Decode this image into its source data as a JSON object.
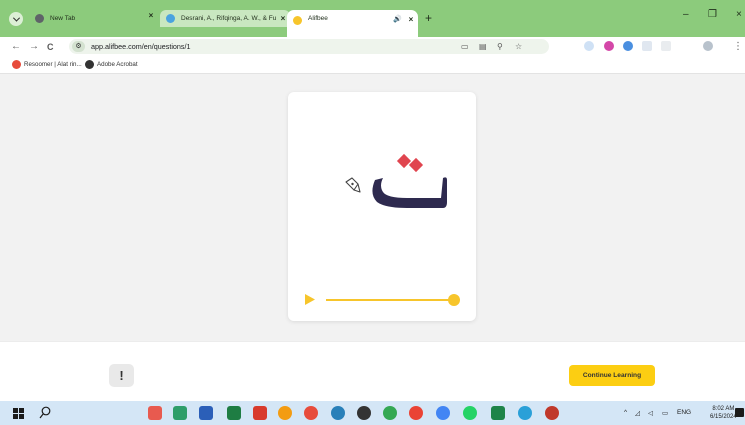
{
  "browser": {
    "tabs": [
      {
        "title": "New Tab",
        "favicon_color": "#5f6368"
      },
      {
        "title": "Desrani, A., Rifqinga, A. W., & Fu",
        "favicon_color": "#4aa3df"
      },
      {
        "title": "Alifbee",
        "favicon_color": "#f7c52b"
      }
    ],
    "new_tab_label": "+",
    "close_glyph": "×",
    "sound_glyph": "🔊",
    "window_controls": {
      "minimize": "–",
      "maximize": "❐",
      "close": "×"
    },
    "url": "app.alifbee.com/en/questions/1",
    "bookmarks": [
      {
        "label": "Resoomer | Alat rin...",
        "icon_color": "#e74c3c"
      },
      {
        "label": "Adobe Acrobat",
        "icon_color": "#333333"
      }
    ],
    "nav": {
      "back": "←",
      "forward": "→",
      "reload": "C"
    }
  },
  "question": {
    "letter": "ت",
    "letter_color": "#2e2a4f",
    "dot_color": "#e0454f",
    "accent_color": "#f7c52b",
    "audio_progress": 1.0,
    "icons": [
      "pen-icon",
      "play-icon"
    ]
  },
  "footer": {
    "report_label": "!",
    "continue_label": "Continue Learning",
    "continue_color": "#fcce12"
  },
  "taskbar": {
    "tray_language": "ENG",
    "clock_time": "8:02 AM",
    "clock_date": "6/15/2024"
  }
}
